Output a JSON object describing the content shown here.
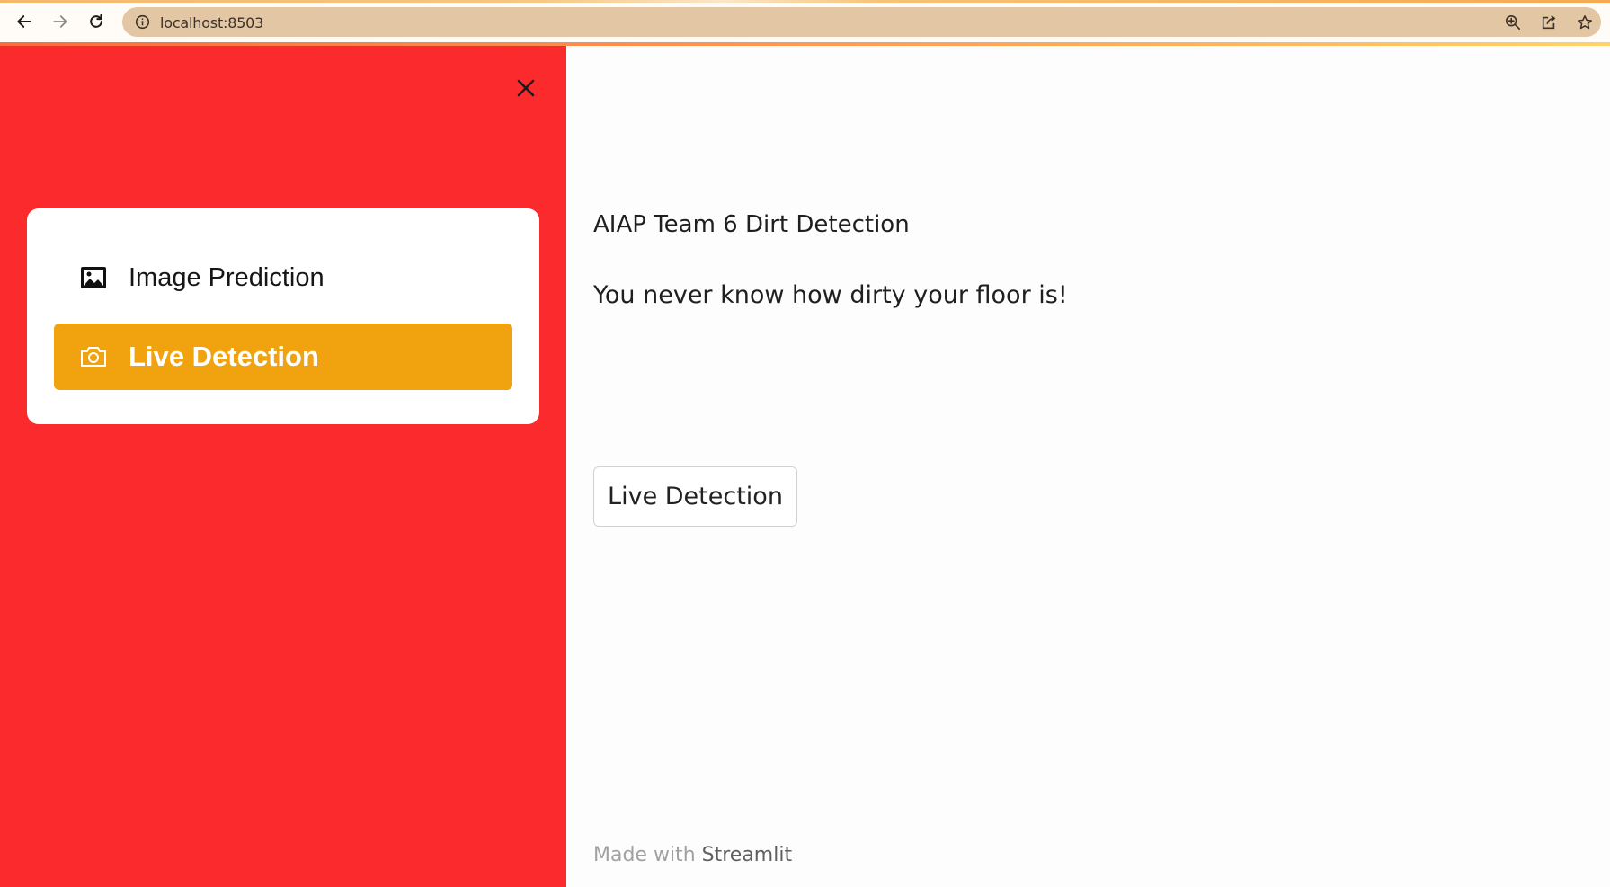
{
  "browser": {
    "url": "localhost:8503",
    "icons": {
      "back": "arrow-left-icon",
      "forward": "arrow-right-icon",
      "reload": "reload-icon",
      "site_info": "info-icon",
      "zoom": "zoom-in-icon",
      "share": "share-icon",
      "bookmark": "star-icon"
    }
  },
  "sidebar": {
    "background": "#fb2a2c",
    "close_icon": "close-icon",
    "menu": [
      {
        "label": "Image Prediction",
        "icon": "image-icon",
        "selected": false
      },
      {
        "label": "Live Detection",
        "icon": "camera-icon",
        "selected": true
      }
    ],
    "selected_color": "#f0a30f"
  },
  "main": {
    "title": "AIAP Team 6 Dirt Detection",
    "subtitle": "You never know how dirty your floor is!",
    "button_label": "Live Detection"
  },
  "footer": {
    "prefix": "Made with ",
    "brand": "Streamlit"
  }
}
